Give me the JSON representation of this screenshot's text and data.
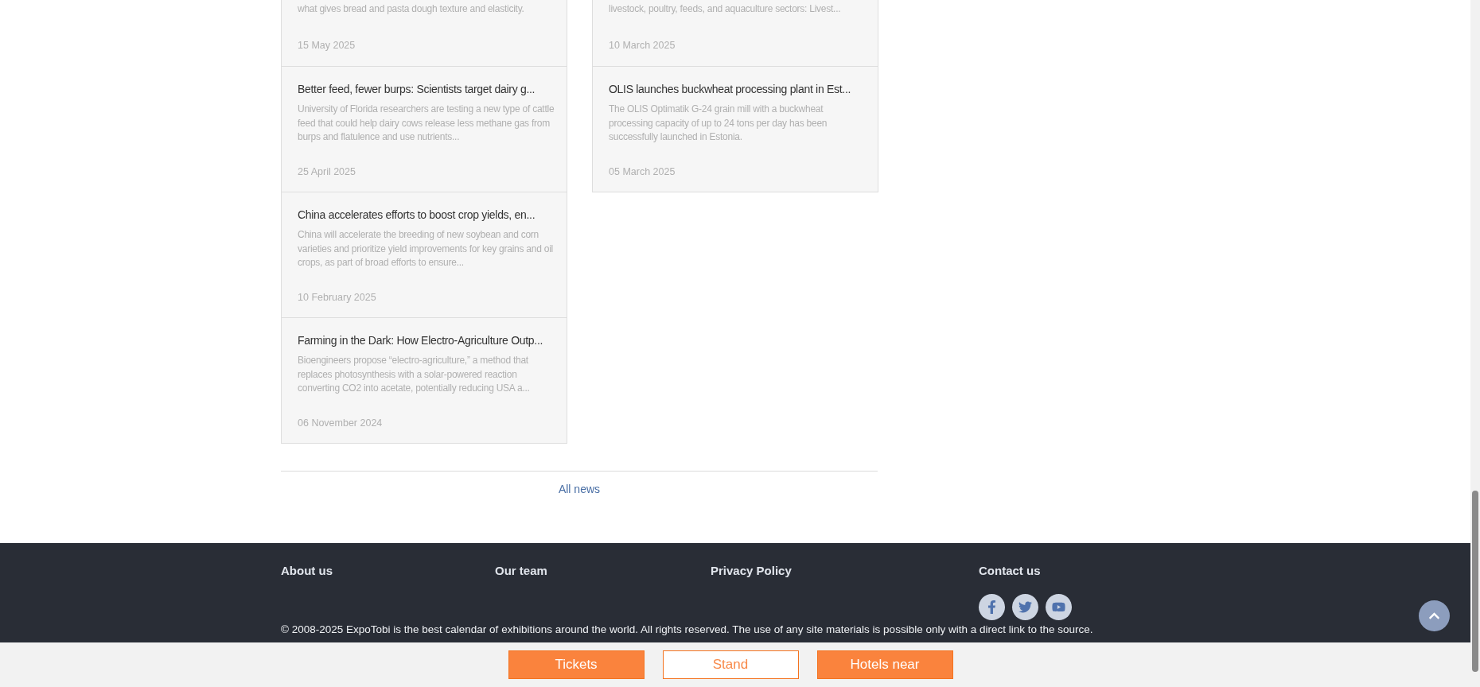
{
  "news": {
    "columns": [
      [
        {
          "excerpt": "what gives bread and pasta dough texture and elasticity.",
          "date": "15 May 2025"
        },
        {
          "title": "Better feed, fewer burps: Scientists target dairy g...",
          "excerpt": "University of Florida researchers are testing a new type of cattle feed that could help dairy cows release less methane gas from burps and flatulence and use nutrients...",
          "date": "25 April 2025"
        },
        {
          "title": "China accelerates efforts to boost crop yields, en...",
          "excerpt": "China will accelerate the breeding of new soybean and corn varieties and prioritize yield improvements for key grains and oil crops, as part of broad efforts to ensure...",
          "date": "10 February 2025"
        },
        {
          "title": "Farming in the Dark: How Electro-Agriculture Outp...",
          "excerpt": "Bioengineers propose “electro-agriculture,” a method that replaces photosynthesis with a solar-powered reaction converting CO2 into acetate, potentially reducing USA a...",
          "date": "06 November 2024"
        }
      ],
      [
        {
          "excerpt": "livestock, poultry, feeds, and aquaculture sectors: Livest...",
          "date": "10 March 2025"
        },
        {
          "title": "OLIS launches buckwheat processing plant in Est...",
          "excerpt": "The OLIS Optimatik G-24 grain mill with a buckwheat processing capacity of up to 24 tons per day has been successfully launched in Estonia.",
          "date": "05 March 2025"
        }
      ]
    ]
  },
  "all_news_link": "All news",
  "footer": {
    "links": [
      "About us",
      "Our team",
      "Privacy Policy"
    ],
    "contact_heading": "Contact us",
    "social": [
      {
        "kind": "facebook"
      },
      {
        "kind": "twitter"
      },
      {
        "kind": "youtube"
      }
    ],
    "copyright": "© 2008-2025 ExpoTobi is the best calendar of exhibitions around the world. All rights reserved. The use of any site materials is possible only with a direct link to the source."
  },
  "action_buttons": [
    {
      "label": "Tickets",
      "kind": "filled"
    },
    {
      "label": "Stand",
      "kind": "outline"
    },
    {
      "label": "Hotels near",
      "kind": "filled"
    }
  ]
}
